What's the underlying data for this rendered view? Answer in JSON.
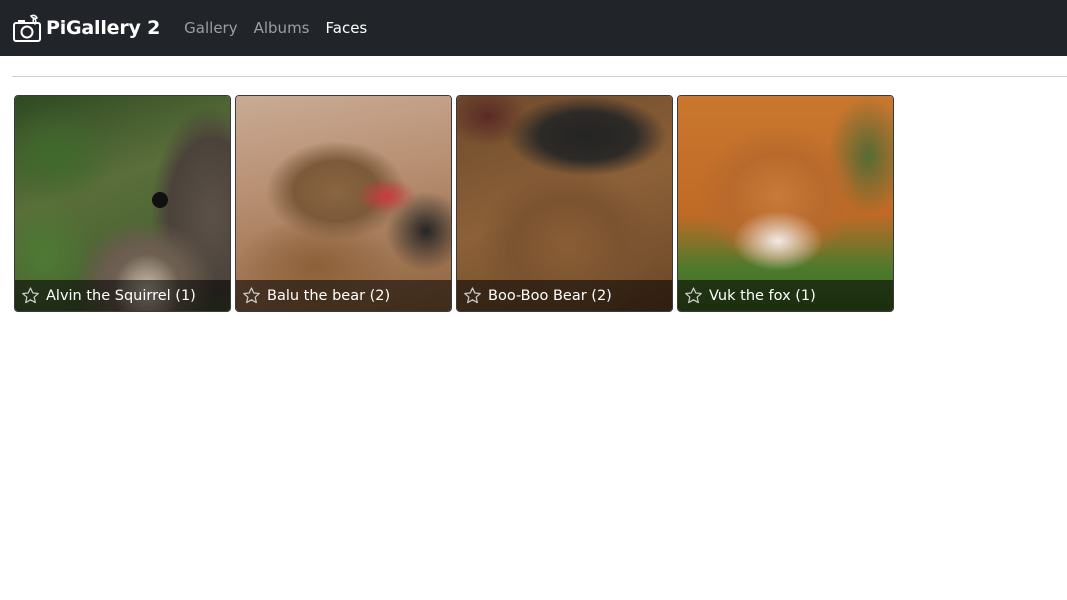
{
  "navbar": {
    "brand_name": "PiGallery 2",
    "links": [
      {
        "label": "Gallery",
        "active": false
      },
      {
        "label": "Albums",
        "active": false
      },
      {
        "label": "Faces",
        "active": true
      }
    ]
  },
  "faces": [
    {
      "label": "Alvin the Squirrel (1)",
      "favorite": false
    },
    {
      "label": "Balu the bear (2)",
      "favorite": false
    },
    {
      "label": "Boo-Boo Bear (2)",
      "favorite": false
    },
    {
      "label": "Vuk the fox (1)",
      "favorite": false
    }
  ],
  "colors": {
    "navbar_bg": "#212529",
    "nav_link": "#8c8f92",
    "nav_link_active": "#ffffff"
  }
}
